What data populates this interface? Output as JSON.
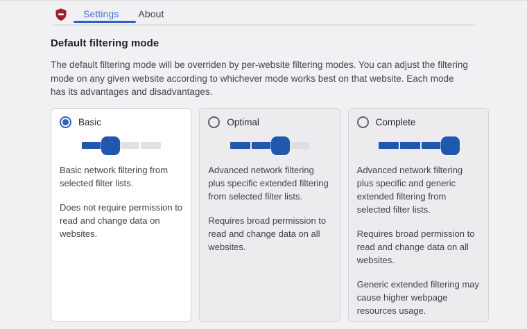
{
  "header": {
    "logo": "ubo-lite-shield-icon",
    "tabs": [
      {
        "label": "Settings",
        "active": true
      },
      {
        "label": "About",
        "active": false
      }
    ]
  },
  "page": {
    "title": "Default filtering mode",
    "description": "The default filtering mode will be overriden by per-website filtering modes. You can adjust the filtering mode on any given website according to whichever mode works best on that website. Each mode has its advantages and disadvantages."
  },
  "modes": [
    {
      "label": "Basic",
      "selected": true,
      "slider_value": 1,
      "slider_max": 3,
      "paragraphs": [
        "Basic network filtering from selected filter lists.",
        "Does not require permission to read and change data on websites."
      ]
    },
    {
      "label": "Optimal",
      "selected": false,
      "slider_value": 2,
      "slider_max": 3,
      "paragraphs": [
        "Advanced network filtering plus specific extended filtering from selected filter lists.",
        "Requires broad permission to read and change data on all websites."
      ]
    },
    {
      "label": "Complete",
      "selected": false,
      "slider_value": 3,
      "slider_max": 3,
      "paragraphs": [
        "Advanced network filtering plus specific and generic extended filtering from selected filter lists.",
        "Requires broad permission to read and change data on all websites.",
        "Generic extended filtering may cause higher webpage resources usage."
      ]
    }
  ],
  "colors": {
    "accent_blue": "#2257ae",
    "tab_blue": "#4272d8",
    "logo_red": "#a01d30",
    "page_bg": "#f1f1f3",
    "card_bg_unselected": "#ececee",
    "card_bg_selected": "#ffffff"
  }
}
